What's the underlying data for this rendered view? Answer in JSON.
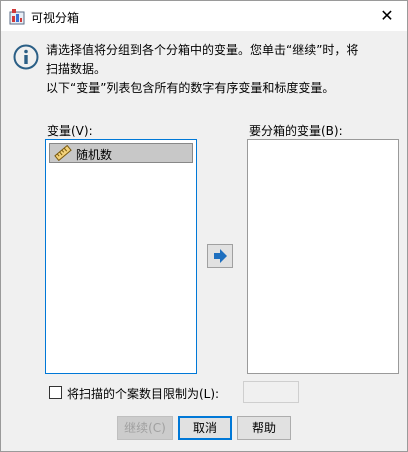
{
  "window": {
    "title": "可视分箱",
    "close_glyph": "✕"
  },
  "info": {
    "lines": [
      "请选择值将分组到各个分箱中的变量。您单击“继续”时，将",
      "扫描数据。",
      "以下“变量”列表包含所有的数字有序变量和标度变量。"
    ]
  },
  "variables": {
    "label": "变量(V):",
    "items": [
      {
        "name": "随机数",
        "icon": "ruler-icon"
      }
    ]
  },
  "bin_vars": {
    "label": "要分箱的变量(B):",
    "items": []
  },
  "move_button": {
    "icon": "arrow-right-icon"
  },
  "limit": {
    "label": "将扫描的个案数目限制为(L):",
    "checked": false,
    "value": ""
  },
  "buttons": {
    "continue": "继续(C)",
    "cancel": "取消",
    "help": "帮助"
  },
  "colors": {
    "accent": "#0078d7",
    "info_icon": "#2b5f86",
    "arrow": "#1e6fbf"
  }
}
